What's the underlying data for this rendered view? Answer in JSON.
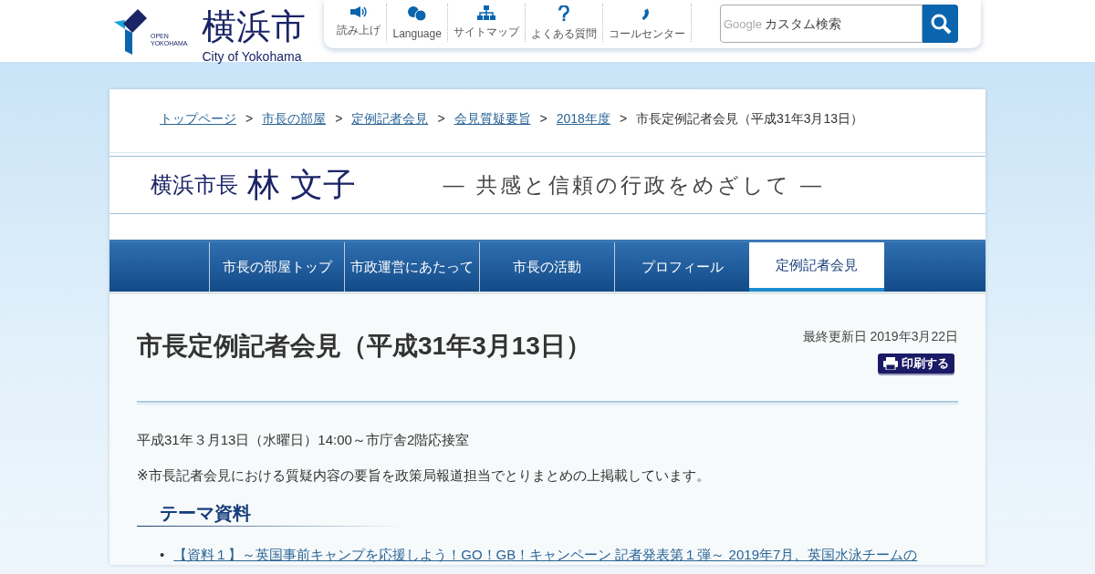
{
  "header": {
    "logo": {
      "open_text": "OPEN",
      "yokohama_text": "YOKOHAMA",
      "city_name": "横浜市",
      "city_name_en": "City of Yokohama"
    },
    "tools": [
      {
        "kind": "speaker",
        "label": "読み上げ"
      },
      {
        "kind": "language",
        "label": "Language"
      },
      {
        "kind": "sitemap",
        "label": "サイトマップ"
      },
      {
        "kind": "faq",
        "label": "よくある質問"
      },
      {
        "kind": "phone",
        "label": "コールセンター"
      }
    ],
    "search": {
      "brand": "Google",
      "placeholder": "カスタム検索"
    }
  },
  "breadcrumb": [
    {
      "label": "トップページ",
      "link": true
    },
    {
      "label": "市長の部屋",
      "link": true
    },
    {
      "label": "定例記者会見",
      "link": true
    },
    {
      "label": "会見質疑要旨",
      "link": true
    },
    {
      "label": "2018年度",
      "link": true
    },
    {
      "label": "市長定例記者会見（平成31年3月13日）",
      "link": false
    }
  ],
  "breadcrumb_separator": ">",
  "banner": {
    "prefix": "横浜市長",
    "name": "林 文子",
    "slogan": "― 共感と信頼の行政をめざして ―"
  },
  "tabs": [
    {
      "label": "市長の部屋トップ",
      "selected": false
    },
    {
      "label": "市政運営にあたって",
      "selected": false
    },
    {
      "label": "市長の活動",
      "selected": false
    },
    {
      "label": "プロフィール",
      "selected": false
    },
    {
      "label": "定例記者会見",
      "selected": true
    }
  ],
  "page": {
    "title": "市長定例記者会見（平成31年3月13日）",
    "updated": "最終更新日 2019年3月22日",
    "print_button": "印刷する",
    "paragraphs": [
      "平成31年３月13日（水曜日）14:00～市庁舎2階応接室",
      "※市長記者会見における質疑内容の要旨を政策局報道担当でとりまとめの上掲載しています。"
    ],
    "section_heading": "テーマ資料",
    "list_marker": "•",
    "links": [
      "【資料１】～英国事前キャンプを応援しよう！GO！GB！キャンペーン 記者発表第１弾～ 2019年7月、英国水泳チームの"
    ]
  }
}
